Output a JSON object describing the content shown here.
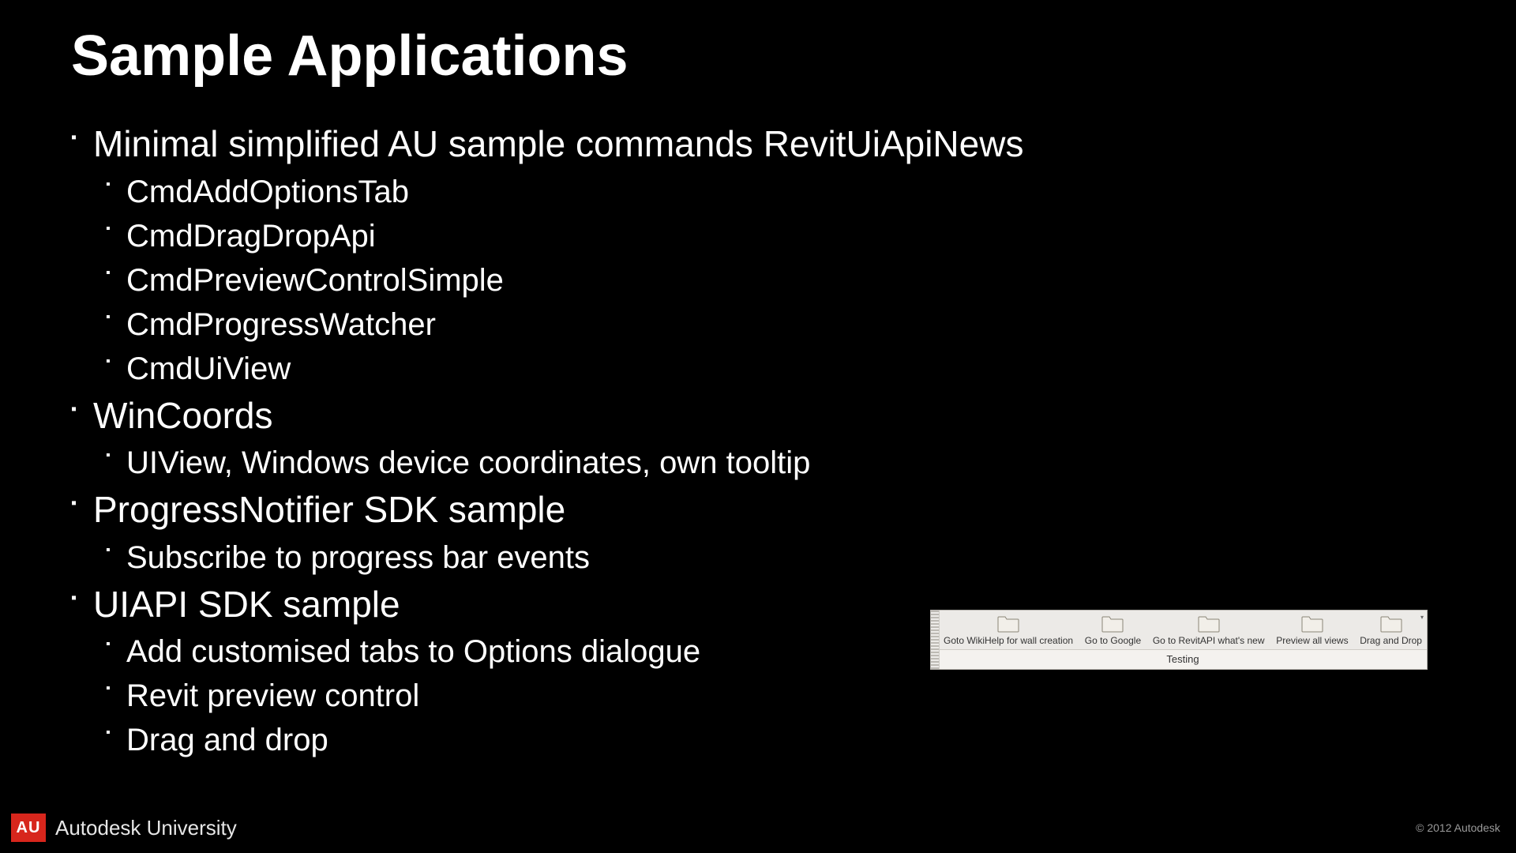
{
  "title": "Sample Applications",
  "bullets": {
    "b1": "Minimal simplified AU sample commands RevitUiApiNews",
    "b1_sub": {
      "s1": "CmdAddOptionsTab",
      "s2": "CmdDragDropApi",
      "s3": "CmdPreviewControlSimple",
      "s4": "CmdProgressWatcher",
      "s5": "CmdUiView"
    },
    "b2": "WinCoords",
    "b2_sub": {
      "s1": "UIView, Windows device coordinates, own tooltip"
    },
    "b3": "ProgressNotifier SDK sample",
    "b3_sub": {
      "s1": "Subscribe to progress bar events"
    },
    "b4": "UIAPI SDK sample",
    "b4_sub": {
      "s1": "Add customised tabs to Options dialogue",
      "s2": "Revit preview control",
      "s3": "Drag and drop"
    }
  },
  "ribbon": {
    "items": {
      "i1": "Goto WikiHelp for wall creation",
      "i2": "Go to Google",
      "i3": "Go to RevitAPI what's new",
      "i4": "Preview all views",
      "i5": "Drag and Drop"
    },
    "tab": "Testing"
  },
  "footer": {
    "logo_text": "AU",
    "brand": "Autodesk University",
    "copyright": "© 2012 Autodesk"
  }
}
